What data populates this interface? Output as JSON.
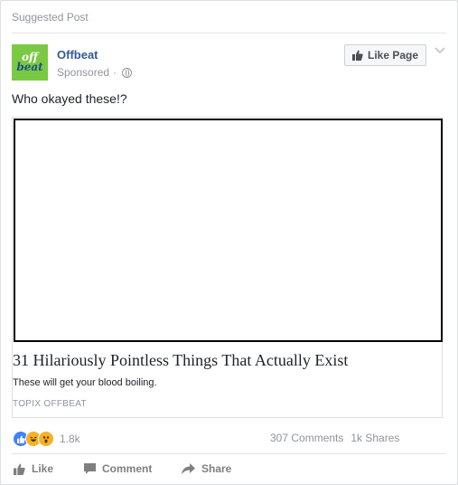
{
  "header": {
    "suggested_label": "Suggested Post"
  },
  "page": {
    "logo_line1": "off",
    "logo_line2": "beat",
    "name": "Offbeat",
    "sponsored": "Sponsored",
    "separator": "·"
  },
  "actions_top": {
    "like_page_label": "Like Page"
  },
  "post": {
    "text": "Who okayed these!?"
  },
  "link": {
    "headline": "31 Hilariously Pointless Things That Actually Exist",
    "description": "These will get your blood boiling.",
    "domain": "TOPIX OFFBEAT"
  },
  "stats": {
    "reactions_count": "1.8k",
    "comments": "307 Comments",
    "shares": "1k Shares"
  },
  "footer": {
    "like": "Like",
    "comment": "Comment",
    "share": "Share"
  },
  "colors": {
    "brand_blue": "#365899",
    "logo_green": "#7ac943",
    "like_reaction": "#4080ff",
    "haha_reaction": "#f7b125"
  }
}
